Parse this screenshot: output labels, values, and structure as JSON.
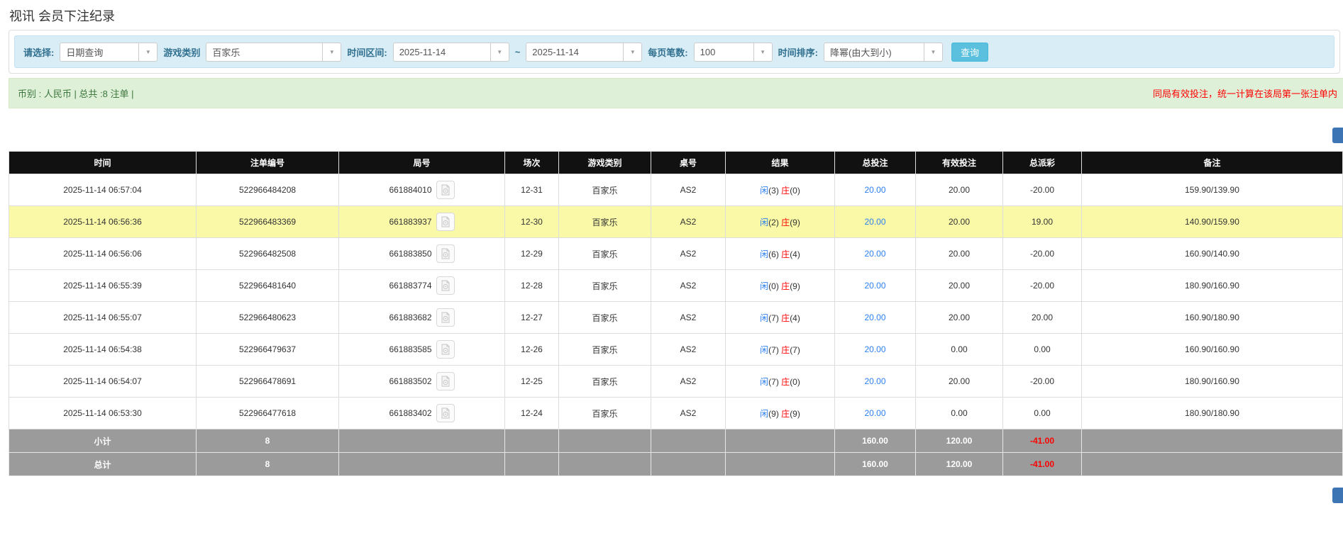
{
  "page": {
    "title": "视讯 会员下注纪录"
  },
  "filters": {
    "select_label": "请选择:",
    "select_value": "日期查询",
    "game_type_label": "游戏类别",
    "game_type_value": "百家乐",
    "time_range_label": "时间区间:",
    "date_from": "2025-11-14",
    "range_separator": "~",
    "date_to": "2025-11-14",
    "page_size_label": "每页笔数:",
    "page_size_value": "100",
    "sort_label": "时间排序:",
    "sort_value": "降幂(由大到小)",
    "query_button": "查询"
  },
  "info_bar": {
    "left_text": "币别 : 人民币 | 总共 :8 注单 |",
    "right_text": "同局有效投注，统一计算在该局第一张注单内"
  },
  "table": {
    "headers": [
      "时间",
      "注单编号",
      "局号",
      "场次",
      "游戏类别",
      "桌号",
      "结果",
      "总投注",
      "有效投注",
      "总派彩",
      "备注"
    ],
    "rows": [
      {
        "time": "2025-11-14 06:57:04",
        "bet_id": "522966484208",
        "round_id": "661884010",
        "session": "12-31",
        "game": "百家乐",
        "table_no": "AS2",
        "player_label": "闲",
        "player_score": "(3)",
        "banker_label": "庄",
        "banker_score": "(0)",
        "total_bet": "20.00",
        "valid_bet": "20.00",
        "payout": "-20.00",
        "note": "159.90/139.90",
        "highlighted": false
      },
      {
        "time": "2025-11-14 06:56:36",
        "bet_id": "522966483369",
        "round_id": "661883937",
        "session": "12-30",
        "game": "百家乐",
        "table_no": "AS2",
        "player_label": "闲",
        "player_score": "(2)",
        "banker_label": "庄",
        "banker_score": "(9)",
        "total_bet": "20.00",
        "valid_bet": "20.00",
        "payout": "19.00",
        "note": "140.90/159.90",
        "highlighted": true
      },
      {
        "time": "2025-11-14 06:56:06",
        "bet_id": "522966482508",
        "round_id": "661883850",
        "session": "12-29",
        "game": "百家乐",
        "table_no": "AS2",
        "player_label": "闲",
        "player_score": "(6)",
        "banker_label": "庄",
        "banker_score": "(4)",
        "total_bet": "20.00",
        "valid_bet": "20.00",
        "payout": "-20.00",
        "note": "160.90/140.90",
        "highlighted": false
      },
      {
        "time": "2025-11-14 06:55:39",
        "bet_id": "522966481640",
        "round_id": "661883774",
        "session": "12-28",
        "game": "百家乐",
        "table_no": "AS2",
        "player_label": "闲",
        "player_score": "(0)",
        "banker_label": "庄",
        "banker_score": "(9)",
        "total_bet": "20.00",
        "valid_bet": "20.00",
        "payout": "-20.00",
        "note": "180.90/160.90",
        "highlighted": false
      },
      {
        "time": "2025-11-14 06:55:07",
        "bet_id": "522966480623",
        "round_id": "661883682",
        "session": "12-27",
        "game": "百家乐",
        "table_no": "AS2",
        "player_label": "闲",
        "player_score": "(7)",
        "banker_label": "庄",
        "banker_score": "(4)",
        "total_bet": "20.00",
        "valid_bet": "20.00",
        "payout": "20.00",
        "note": "160.90/180.90",
        "highlighted": false
      },
      {
        "time": "2025-11-14 06:54:38",
        "bet_id": "522966479637",
        "round_id": "661883585",
        "session": "12-26",
        "game": "百家乐",
        "table_no": "AS2",
        "player_label": "闲",
        "player_score": "(7)",
        "banker_label": "庄",
        "banker_score": "(7)",
        "total_bet": "20.00",
        "valid_bet": "0.00",
        "payout": "0.00",
        "note": "160.90/160.90",
        "highlighted": false
      },
      {
        "time": "2025-11-14 06:54:07",
        "bet_id": "522966478691",
        "round_id": "661883502",
        "session": "12-25",
        "game": "百家乐",
        "table_no": "AS2",
        "player_label": "闲",
        "player_score": "(7)",
        "banker_label": "庄",
        "banker_score": "(0)",
        "total_bet": "20.00",
        "valid_bet": "20.00",
        "payout": "-20.00",
        "note": "180.90/160.90",
        "highlighted": false
      },
      {
        "time": "2025-11-14 06:53:30",
        "bet_id": "522966477618",
        "round_id": "661883402",
        "session": "12-24",
        "game": "百家乐",
        "table_no": "AS2",
        "player_label": "闲",
        "player_score": "(9)",
        "banker_label": "庄",
        "banker_score": "(9)",
        "total_bet": "20.00",
        "valid_bet": "0.00",
        "payout": "0.00",
        "note": "180.90/180.90",
        "highlighted": false
      }
    ],
    "subtotal": {
      "label": "小计",
      "count": "8",
      "total_bet": "160.00",
      "valid_bet": "120.00",
      "payout": "-41.00"
    },
    "total": {
      "label": "总计",
      "count": "8",
      "total_bet": "160.00",
      "valid_bet": "120.00",
      "payout": "-41.00"
    }
  },
  "colors": {
    "accent_info": "#5bc0de",
    "filter_bar_bg": "#d9edf7",
    "success_bg": "#dff0d8",
    "success_text": "#3c763d",
    "danger_text": "#ff0000",
    "link_blue": "#2b7ff2",
    "header_bg": "#111111",
    "highlight_row": "#f9f9a8",
    "summary_row_bg": "#9b9b9b",
    "edge_button_blue": "#3d74b4"
  }
}
